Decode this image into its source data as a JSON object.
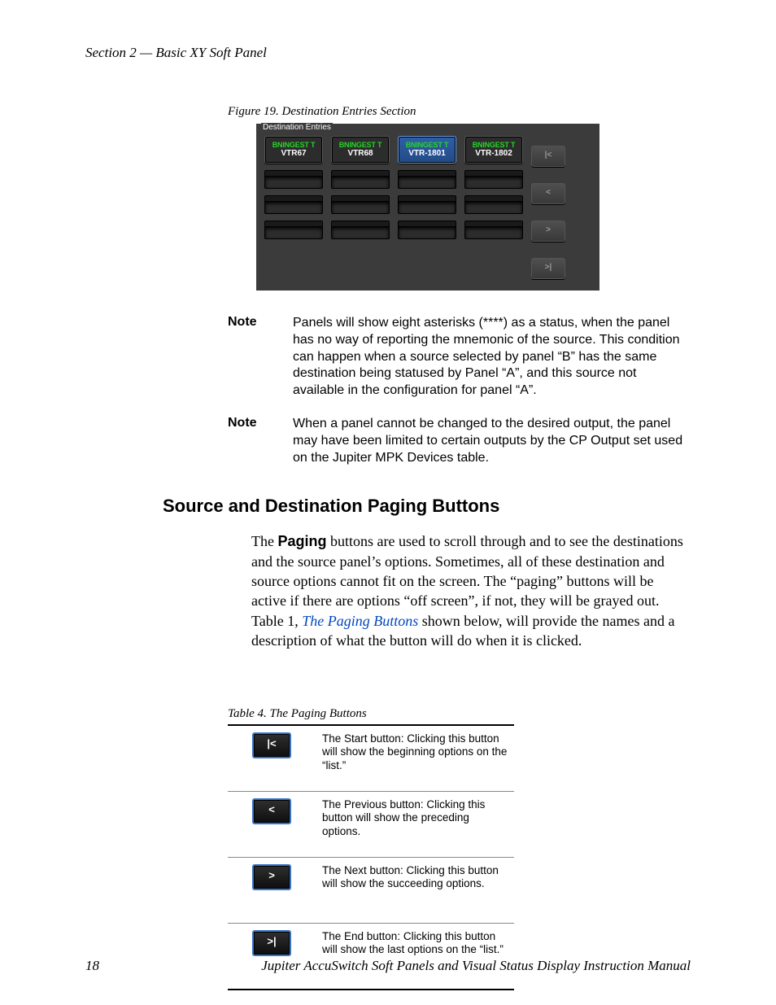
{
  "header": {
    "section": "Section 2 — Basic XY Soft Panel"
  },
  "figure": {
    "caption": "Figure 19.  Destination Entries Section",
    "fieldset_label": "Destination Entries",
    "entries": [
      {
        "top": "BNINGEST T",
        "bottom": "VTR67"
      },
      {
        "top": "BNINGEST T",
        "bottom": "VTR68"
      },
      {
        "top": "BNINGEST T",
        "bottom": "VTR-1801"
      },
      {
        "top": "BNINGEST T",
        "bottom": "VTR-1802"
      }
    ],
    "nav": {
      "first": "|<",
      "prev": "<",
      "next": ">",
      "last": ">|"
    }
  },
  "notes": [
    {
      "label": "Note",
      "text": "Panels will show eight asterisks (****) as a status, when the panel has no way of reporting the mnemonic of the source. This condition can happen when a source selected by panel “B” has the same destination being statused by Panel “A”, and this source not available in the configuration for panel “A”."
    },
    {
      "label": "Note",
      "text": "When a panel cannot be changed to the desired output, the panel may have been limited to certain outputs by the CP Output set used on the Jupiter MPK Devices table."
    }
  ],
  "section_heading": "Source and Destination Paging Buttons",
  "paragraph": {
    "pre": "The ",
    "bold": "Paging",
    "mid": " buttons are used to scroll through and to see the destinations and the source panel’s options. Sometimes, all of these destination and source options cannot fit on the screen. The “paging” buttons will be active if there are options “off screen”, if not, they will be grayed out. Table 1, ",
    "link": "The Paging Buttons",
    "post": " shown below, will provide the names and a description of what the button will do when it is clicked."
  },
  "table": {
    "caption": "Table 4.  The Paging Buttons",
    "rows": [
      {
        "glyph": "|<",
        "desc": "The Start button: Clicking this button will show the beginning options on the “list.”"
      },
      {
        "glyph": "<",
        "desc": "The Previous button: Clicking this button will show the preceding options."
      },
      {
        "glyph": ">",
        "desc": "The Next button: Clicking this button will show the succeeding options."
      },
      {
        "glyph": ">|",
        "desc": "The End button: Clicking this button will show the last options on the “list.”"
      }
    ]
  },
  "footer": {
    "page": "18",
    "title": "Jupiter AccuSwitch Soft Panels and Visual Status Display Instruction Manual"
  }
}
